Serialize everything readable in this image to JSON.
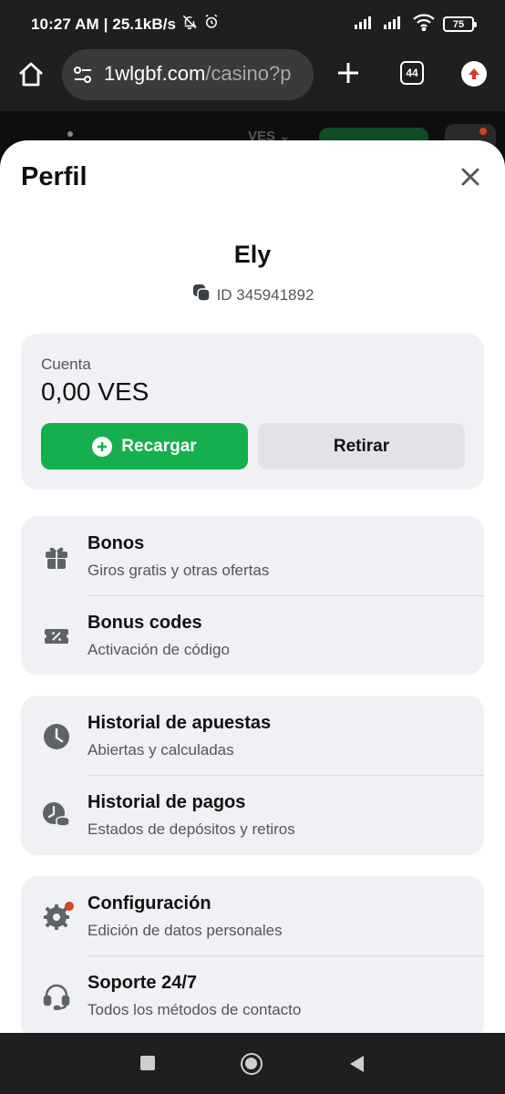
{
  "status_bar": {
    "time": "10:27 AM | 25.1kB/s",
    "battery": "75"
  },
  "browser": {
    "url_main": "1wlgbf.com",
    "url_path": "/casino?p",
    "tab_count": "44"
  },
  "behind_page": {
    "currency": "VES"
  },
  "sheet": {
    "title": "Perfil",
    "user": {
      "name": "Ely",
      "id": "ID 345941892"
    },
    "account": {
      "label": "Cuenta",
      "balance": "0,00 VES",
      "deposit_label": "Recargar",
      "withdraw_label": "Retirar"
    },
    "menu": [
      {
        "title": "Bonos",
        "subtitle": "Giros gratis y otras ofertas",
        "icon": "gift-icon"
      },
      {
        "title": "Bonus codes",
        "subtitle": "Activación de código",
        "icon": "coupon-icon"
      },
      {
        "title": "Historial de apuestas",
        "subtitle": "Abiertas y calculadas",
        "icon": "clock-icon"
      },
      {
        "title": "Historial de pagos",
        "subtitle": "Estados de depósitos y retiros",
        "icon": "payment-history-icon"
      },
      {
        "title": "Configuración",
        "subtitle": "Edición de datos personales",
        "icon": "gear-icon"
      },
      {
        "title": "Soporte 24/7",
        "subtitle": "Todos los métodos de contacto",
        "icon": "headset-icon"
      }
    ]
  },
  "colors": {
    "accent_green": "#15b04d",
    "notification_red": "#d9441c",
    "card_bg": "#f0f1f5"
  }
}
